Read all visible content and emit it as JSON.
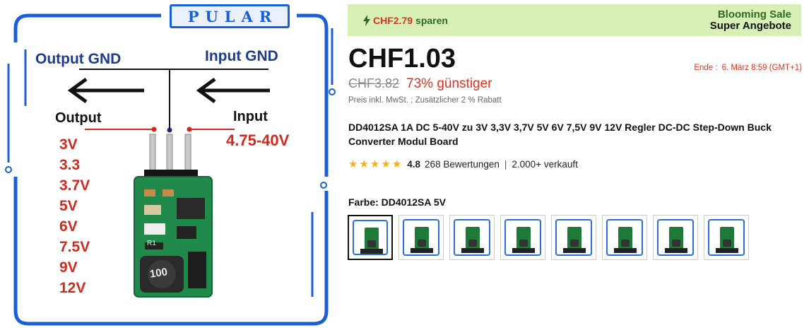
{
  "image": {
    "brand": "PULAR",
    "labels": {
      "output_gnd": "Output GND",
      "input_gnd": "Input GND",
      "output": "Output",
      "input": "Input",
      "input_range": "4.75-40V",
      "inductor_marking": "100",
      "resistor_marking": "R1"
    },
    "output_voltages": [
      "3V",
      "3.3",
      "3.7V",
      "5V",
      "6V",
      "7.5V",
      "9V",
      "12V"
    ]
  },
  "promo": {
    "savings_amount": "CHF2.79",
    "savings_suffix": "sparen",
    "sale_name": "Blooming Sale",
    "sale_subtitle": "Super Angebote"
  },
  "price": {
    "current": "CHF1.03",
    "original": "CHF3.82",
    "discount": "73% günstiger",
    "note": "Preis inkl. MwSt. ; Zusätzlicher 2 % Rabatt"
  },
  "sale_end": {
    "label": "Ende :",
    "value": "6. März 8:59 (GMT+1)"
  },
  "product": {
    "title": "DD4012SA 1A DC 5-40V zu 3V 3,3V 3,7V 5V 6V 7,5V 9V 12V Regler DC-DC Step-Down Buck Converter Modul Board"
  },
  "rating": {
    "value": "4.8",
    "reviews": "268 Bewertungen",
    "sold": "2.000+ verkauft",
    "stars": 5
  },
  "variant": {
    "label": "Farbe: DD4012SA 5V",
    "swatch_count": 8,
    "selected_index": 0
  },
  "colors": {
    "accent_red": "#e0301e",
    "promo_bg": "#d8f0b6",
    "star": "#f2b01e"
  }
}
